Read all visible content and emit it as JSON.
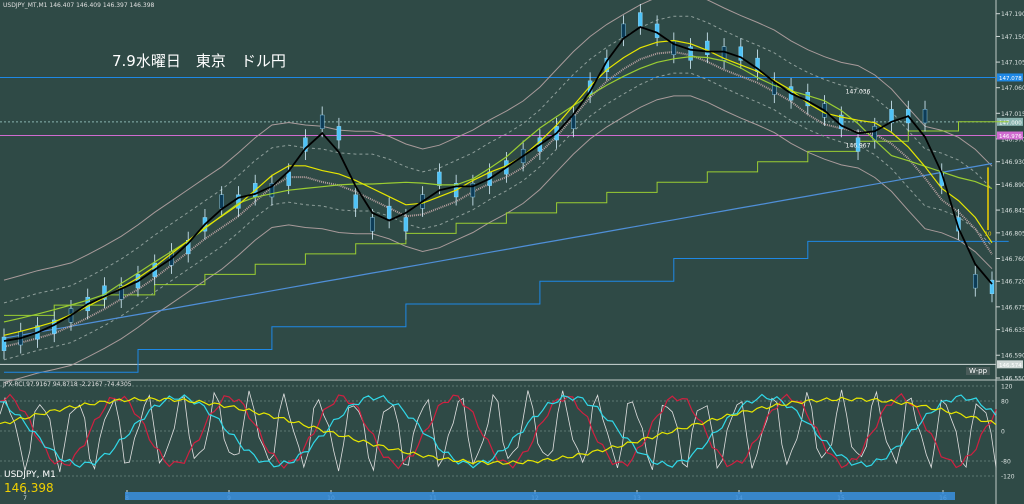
{
  "chart_data": [
    {
      "type": "line",
      "header": "USDJPY_MT,M1  146.407 146.409 146.397 146.398",
      "annotation": "7.9水曜日　東京　ドル円",
      "y_ticks": [
        "147.190",
        "147.150",
        "147.105",
        "147.060",
        "147.015",
        "146.970",
        "146.930",
        "146.890",
        "146.845",
        "146.805",
        "146.760",
        "146.720",
        "146.675",
        "146.635",
        "146.590",
        "146.550"
      ],
      "ylim": [
        146.55,
        147.2
      ],
      "x_ticks": [
        "7",
        "8",
        "9",
        "10",
        "11",
        "12",
        "13",
        "14",
        "15",
        "16"
      ],
      "price_labels": [
        {
          "text": "147.078",
          "value": 147.078,
          "color": "#1e88e5"
        },
        {
          "text": "147.000",
          "value": 147.0,
          "color": "#8ab4b0"
        },
        {
          "text": "146.976",
          "value": 146.976,
          "color": "#d06bd0"
        },
        {
          "text": "146.574",
          "value": 146.574,
          "color": "#cfd8d6"
        }
      ],
      "extra_labels": {
        "high": "147.036",
        "low": "146.967",
        "mark": "10",
        "wpp": "W-pp"
      },
      "series": [
        {
          "values": [
            146.61,
            146.62,
            146.63,
            146.64,
            146.66,
            146.68,
            146.7,
            146.7,
            146.72,
            146.74,
            146.76,
            146.78,
            146.82,
            146.86,
            146.86,
            146.88,
            146.88,
            146.9,
            146.96,
            147.0,
            146.98,
            146.86,
            146.82,
            146.84,
            146.82,
            146.86,
            146.9,
            146.88,
            146.88,
            146.9,
            146.92,
            146.94,
            146.96,
            146.98,
            147.0,
            147.06,
            147.1,
            147.16,
            147.18,
            147.16,
            147.13,
            147.12,
            147.13,
            147.12,
            147.12,
            147.1,
            147.06,
            147.05,
            147.04,
            147.02,
            147.0,
            146.96,
            146.98,
            147.01,
            147.01,
            147.01,
            146.9,
            146.82,
            146.72,
            146.71
          ]
        }
      ]
    },
    {
      "type": "line",
      "header": "JPX-RCI 97.9167 94.8718 -2.2167 -74.4305",
      "y_ticks": [
        "120",
        "80",
        "0",
        "-80",
        "-120"
      ],
      "ylim": [
        -120,
        120
      ],
      "series": []
    }
  ],
  "bottom": {
    "symbol": "USDJPY, M1",
    "price": "146.398"
  },
  "colors": {
    "bg": "#2f4a46",
    "up": "#4fc3f7",
    "ma_fast": "#000000",
    "ma_mid": "#e6e600",
    "ma_slow": "#9acd32",
    "ma_long": "#4f8fd8",
    "ichimoku": "#b8a0a0",
    "line_blue": "#1e88e5",
    "line_pink": "#d06bd0",
    "line_green": "#9acd32"
  }
}
